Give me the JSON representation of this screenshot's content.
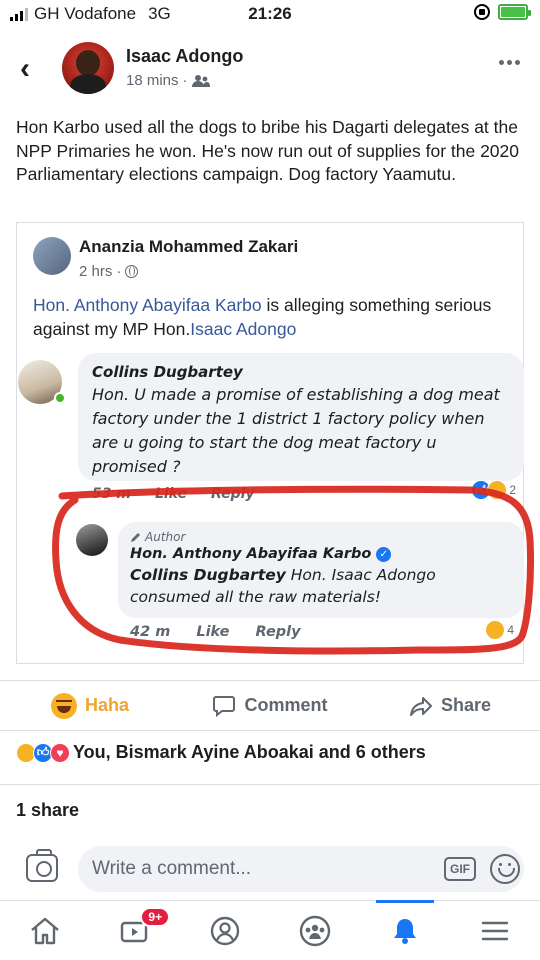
{
  "status_bar": {
    "carrier": "GH Vodafone",
    "network": "3G",
    "time": "21:26"
  },
  "post": {
    "author": "Isaac Adongo",
    "time": "18 mins",
    "privacy_icon": "friends-icon",
    "text": "Hon Karbo used all the dogs to bribe his Dagarti delegates at the NPP Primaries he won. He's now run out of supplies for the 2020 Parliamentary elections campaign. Dog factory Yaamutu."
  },
  "shared_post": {
    "author": "Ananzia Mohammed Zakari",
    "time": "2 hrs",
    "privacy_icon": "globe-icon",
    "mention1": "Hon. Anthony Abayifaa Karbo",
    "text_middle": " is alleging something serious against my MP Hon.",
    "mention2": "Isaac Adongo"
  },
  "comments": [
    {
      "name": "Collins Dugbartey",
      "text": "Hon. U made a promise of establishing a dog meat factory under the 1 district 1 factory policy when are u going to start the dog meat factory u promised ?",
      "time": "53 m",
      "like_label": "Like",
      "reply_label": "Reply",
      "reaction_count": "2"
    }
  ],
  "reply": {
    "tag": "Author",
    "name": "Hon. Anthony Abayifaa Karbo",
    "mention": "Collins Dugbartey",
    "text": " Hon. Isaac Adongo consumed all the raw materials!",
    "time": "42 m",
    "like_label": "Like",
    "reply_label": "Reply",
    "reaction_count": "4"
  },
  "actions": {
    "haha": "Haha",
    "comment": "Comment",
    "share": "Share"
  },
  "reactions_summary": "You, Bismark Ayine Aboakai and 6 others",
  "shares": "1 share",
  "composer": {
    "placeholder": "Write a comment...",
    "gif": "GIF"
  },
  "bottom_nav": {
    "video_badge": "9+"
  },
  "colors": {
    "link": "#385898",
    "facebook_blue": "#1877f2",
    "haha": "#f7b125",
    "annotation_red": "#d9261c"
  }
}
